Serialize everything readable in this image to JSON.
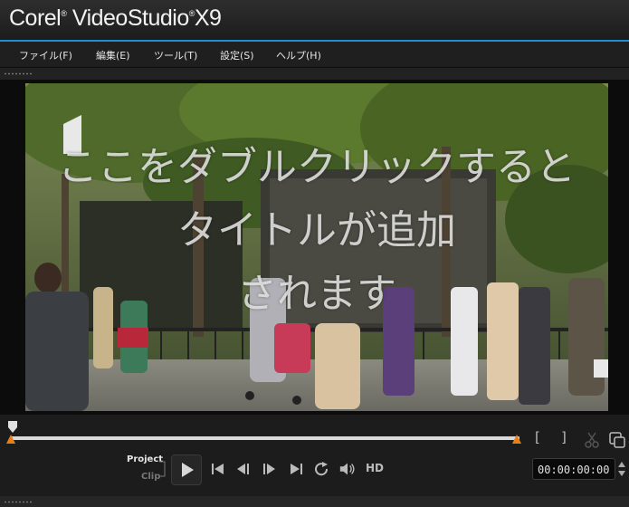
{
  "app": {
    "brand": "Corel",
    "product": "VideoStudio",
    "version": "X9"
  },
  "menu": [
    "ファイル(F)",
    "編集(E)",
    "ツール(T)",
    "設定(S)",
    "ヘルプ(H)"
  ],
  "preview": {
    "title_overlay": [
      "ここをダブルクリックすると",
      "タイトルが追加",
      "されます"
    ]
  },
  "controls": {
    "mode_project": "Project",
    "mode_clip": "Clip",
    "mark_in": "[",
    "mark_out": "]",
    "hd_label": "HD",
    "timecode": "00:00:00:00"
  },
  "colors": {
    "accent": "#1e8fd6",
    "trim_marker": "#e8801a"
  }
}
